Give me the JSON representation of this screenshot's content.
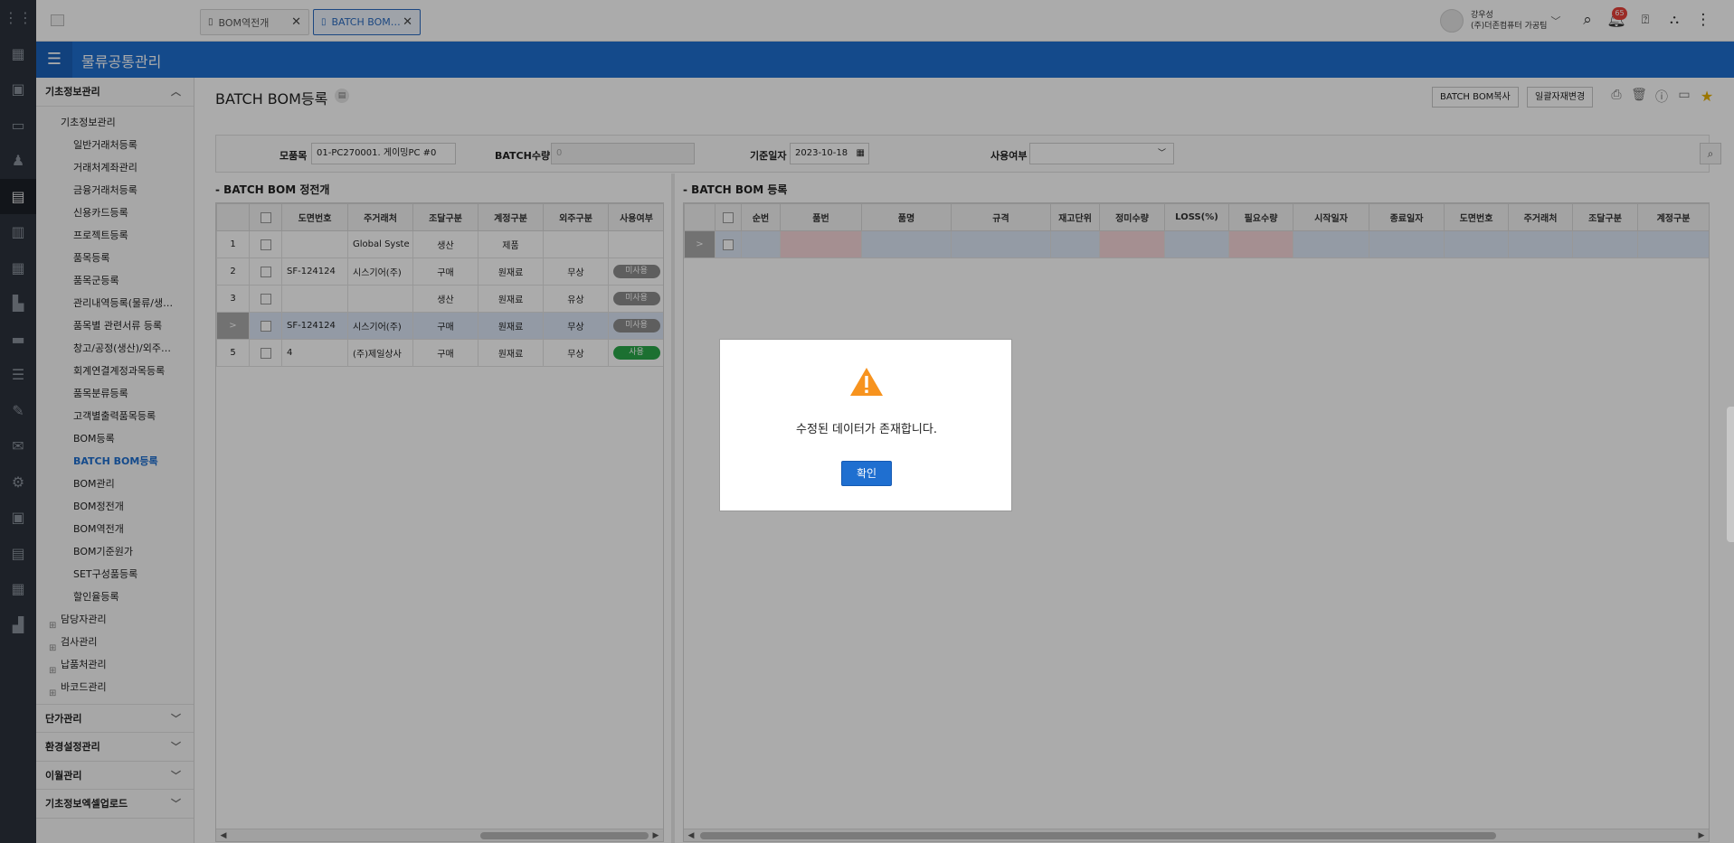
{
  "app": {
    "module_title": "물류공통관리"
  },
  "tabs": [
    {
      "label": "BOM역전개",
      "active": false
    },
    {
      "label": "BATCH BOM…",
      "active": true
    }
  ],
  "user": {
    "name": "강우성",
    "company": "(주)더존컴퓨터 가공팀"
  },
  "notification_count": "65",
  "sidebar": {
    "sections": [
      {
        "label": "기초정보관리",
        "expanded": true
      },
      {
        "label": "단가관리",
        "expanded": false
      },
      {
        "label": "환경설정관리",
        "expanded": false
      },
      {
        "label": "이월관리",
        "expanded": false
      },
      {
        "label": "기초정보엑셀업로드",
        "expanded": false
      }
    ],
    "tree": {
      "root": "기초정보관리",
      "items": [
        "일반거래처등록",
        "거래처계좌관리",
        "금융거래처등록",
        "신용카드등록",
        "프로젝트등록",
        "품목등록",
        "품목군등록",
        "관리내역등록(물류/생…",
        "품목별 관련서류 등록",
        "창고/공정(생산)/외주…",
        "회계연결계정과목등록",
        "품목분류등록",
        "고객별출력품목등록",
        "BOM등록",
        "BATCH BOM등록",
        "BOM관리",
        "BOM정전개",
        "BOM역전개",
        "BOM기준원가",
        "SET구성품등록",
        "할인율등록"
      ],
      "active_item": "BATCH BOM등록",
      "groups": [
        "담당자관리",
        "검사관리",
        "납품처관리",
        "바코드관리"
      ]
    }
  },
  "page": {
    "title": "BATCH BOM등록",
    "buttons": {
      "copy": "BATCH BOM복사",
      "bulk_change": "일괄자재변경"
    }
  },
  "filter": {
    "parent_item_label": "모품목",
    "parent_item_value": "01-PC270001. 게이밍PC #0",
    "batch_qty_label": "BATCH수량",
    "batch_qty_value": "0",
    "base_date_label": "기준일자",
    "base_date_value": "2023-10-18",
    "use_label": "사용여부",
    "use_value": ""
  },
  "left_grid": {
    "title": "BATCH BOM 정전개",
    "columns": [
      "도면번호",
      "주거래처",
      "조달구분",
      "계정구분",
      "외주구분",
      "사용여부"
    ],
    "rows": [
      {
        "no": "1",
        "drawing": "",
        "vendor": "Global Syste",
        "procure": "생산",
        "account": "제품",
        "outsource": "",
        "use": ""
      },
      {
        "no": "2",
        "drawing": "SF-124124",
        "vendor": "시스기어(주)",
        "procure": "구매",
        "account": "원재료",
        "outsource": "무상",
        "use": "미사용"
      },
      {
        "no": "3",
        "drawing": "",
        "vendor": "",
        "procure": "생산",
        "account": "원재료",
        "outsource": "유상",
        "use": "미사용"
      },
      {
        "no": ">",
        "drawing": "SF-124124",
        "vendor": "시스기어(주)",
        "procure": "구매",
        "account": "원재료",
        "outsource": "무상",
        "use": "미사용"
      },
      {
        "no": "5",
        "drawing": "4",
        "vendor": "(주)제일상사",
        "procure": "구매",
        "account": "원재료",
        "outsource": "무상",
        "use": "사용"
      }
    ]
  },
  "right_grid": {
    "title": "BATCH BOM 등록",
    "columns": [
      "순번",
      "품번",
      "품명",
      "규격",
      "재고단위",
      "정미수량",
      "LOSS(%)",
      "필요수량",
      "시작일자",
      "종료일자",
      "도면번호",
      "주거래처",
      "조달구분",
      "계정구분"
    ],
    "row_marker": ">"
  },
  "dialog": {
    "message": "수정된 데이터가 존재합니다.",
    "confirm_label": "확인"
  },
  "colors": {
    "accent": "#1f6fd0",
    "warning": "#f7931e",
    "used": "#2aa84a",
    "unused": "#8c8c8c"
  }
}
